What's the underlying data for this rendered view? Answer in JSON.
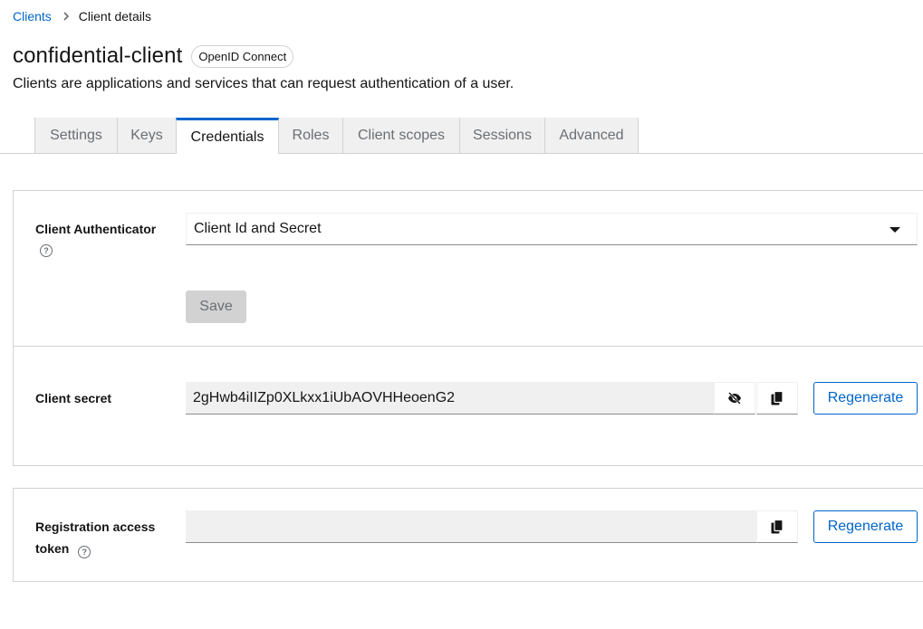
{
  "breadcrumb": {
    "parent": "Clients",
    "current": "Client details"
  },
  "header": {
    "title": "confidential-client",
    "badge": "OpenID Connect",
    "subtitle": "Clients are applications and services that can request authentication of a user."
  },
  "tabs": [
    {
      "label": "Settings",
      "active": false
    },
    {
      "label": "Keys",
      "active": false
    },
    {
      "label": "Credentials",
      "active": true
    },
    {
      "label": "Roles",
      "active": false
    },
    {
      "label": "Client scopes",
      "active": false
    },
    {
      "label": "Sessions",
      "active": false
    },
    {
      "label": "Advanced",
      "active": false
    }
  ],
  "credentials": {
    "authenticator_label": "Client Authenticator",
    "authenticator_value": "Client Id and Secret",
    "save_label": "Save",
    "secret_label": "Client secret",
    "secret_value": "2gHwb4iIIZp0XLkxx1iUbAOVHHeoenG2",
    "regenerate_label": "Regenerate",
    "rat_label_line1": "Registration access",
    "rat_label_line2": "token",
    "rat_value": "",
    "rat_regenerate_label": "Regenerate"
  },
  "colors": {
    "accent": "#0066cc",
    "tab_inactive_bg": "#f0f0f0",
    "border": "#d2d2d2"
  },
  "icons": [
    "chevron-right-icon",
    "help-icon",
    "caret-down-icon",
    "eye-slash-icon",
    "copy-icon"
  ]
}
